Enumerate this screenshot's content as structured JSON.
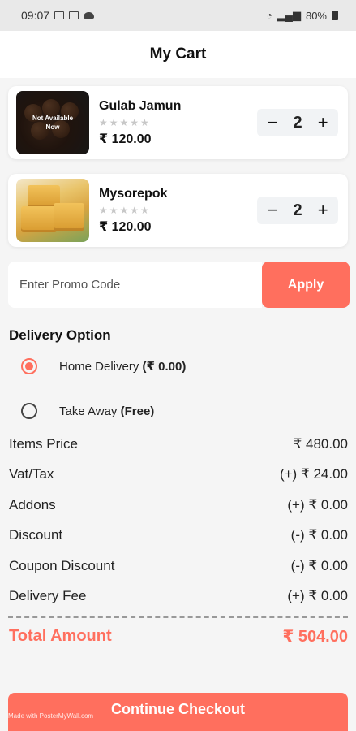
{
  "status_bar": {
    "time": "09:07",
    "signal_text": "WiFi",
    "battery": "80%"
  },
  "header": {
    "title": "My Cart"
  },
  "cart_items": [
    {
      "name": "Gulab Jamun",
      "stars": "★★★★★",
      "price": "₹ 120.00",
      "quantity": "2",
      "overlay": "Not Available Now"
    },
    {
      "name": "Mysorepok",
      "stars": "★★★★★",
      "price": "₹ 120.00",
      "quantity": "2"
    }
  ],
  "qty_controls": {
    "minus": "−",
    "plus": "+"
  },
  "promo": {
    "placeholder": "Enter Promo Code",
    "apply_label": "Apply"
  },
  "delivery": {
    "title": "Delivery Option",
    "options": [
      {
        "label": "Home Delivery",
        "extra": "(₹ 0.00)",
        "selected": true
      },
      {
        "label": "Take Away",
        "extra": "(Free)",
        "selected": false
      }
    ]
  },
  "summary": [
    {
      "label": "Items Price",
      "value": "₹ 480.00"
    },
    {
      "label": "Vat/Tax",
      "value": "(+) ₹ 24.00"
    },
    {
      "label": "Addons",
      "value": "(+) ₹ 0.00"
    },
    {
      "label": "Discount",
      "value": "(-) ₹ 0.00"
    },
    {
      "label": "Coupon Discount",
      "value": "(-) ₹ 0.00"
    },
    {
      "label": "Delivery Fee",
      "value": "(+) ₹ 0.00"
    }
  ],
  "total": {
    "label": "Total Amount",
    "value": "₹ 504.00"
  },
  "checkout": {
    "label": "Continue Checkout"
  },
  "watermark": "Made with PosterMyWall.com",
  "colors": {
    "accent": "#ff6f5e",
    "background": "#f5f5f5"
  }
}
